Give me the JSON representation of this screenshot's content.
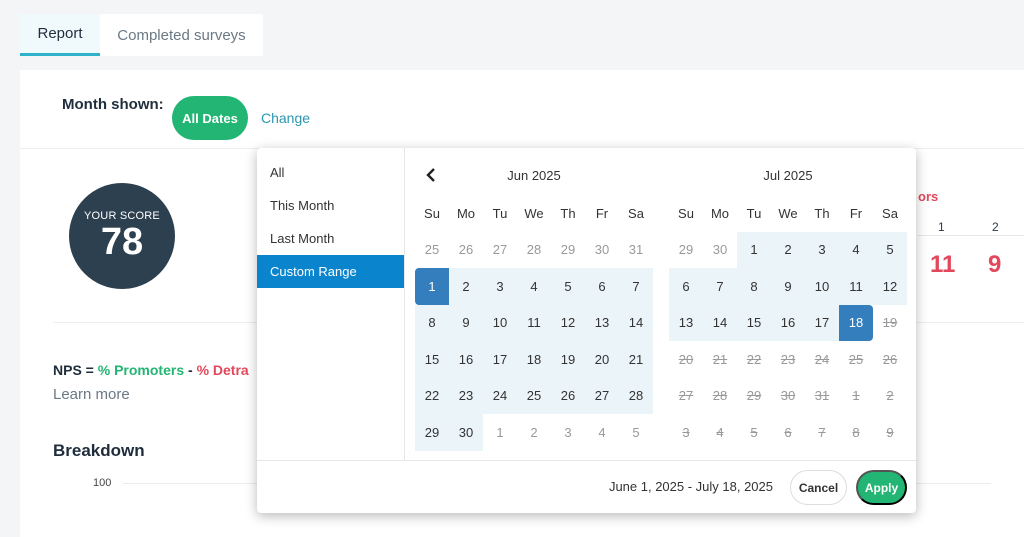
{
  "tabs": [
    {
      "label": "Report",
      "active": true
    },
    {
      "label": "Completed surveys",
      "active": false
    }
  ],
  "month": {
    "label": "Month shown:",
    "badge": "All Dates",
    "change": "Change"
  },
  "score": {
    "caption": "YOUR SCORE",
    "value": "78"
  },
  "nps": {
    "prefix": "NPS = ",
    "promoters": "% Promoters",
    "minus": " - ",
    "detractors": "% Detra"
  },
  "learn_more": "Learn more",
  "breakdown": "Breakdown",
  "axis_top": "100",
  "side": {
    "detractors_label": "ors",
    "col1": "1",
    "col2": "2",
    "count1": "11",
    "count2": "9"
  },
  "picker": {
    "ranges": [
      "All",
      "This Month",
      "Last Month",
      "Custom Range"
    ],
    "active_range": "Custom Range",
    "prev_icon": "chevron-left-icon",
    "weekdays": [
      "Su",
      "Mo",
      "Tu",
      "We",
      "Th",
      "Fr",
      "Sa"
    ],
    "months": [
      {
        "title": "Jun 2025",
        "days": [
          [
            "25",
            "off"
          ],
          [
            "26",
            "off"
          ],
          [
            "27",
            "off"
          ],
          [
            "28",
            "off"
          ],
          [
            "29",
            "off"
          ],
          [
            "30",
            "off"
          ],
          [
            "31",
            "off"
          ],
          [
            "1",
            "start"
          ],
          [
            "2",
            "in"
          ],
          [
            "3",
            "in"
          ],
          [
            "4",
            "in"
          ],
          [
            "5",
            "in"
          ],
          [
            "6",
            "in"
          ],
          [
            "7",
            "in"
          ],
          [
            "8",
            "in"
          ],
          [
            "9",
            "in"
          ],
          [
            "10",
            "in"
          ],
          [
            "11",
            "in"
          ],
          [
            "12",
            "in"
          ],
          [
            "13",
            "in"
          ],
          [
            "14",
            "in"
          ],
          [
            "15",
            "in"
          ],
          [
            "16",
            "in"
          ],
          [
            "17",
            "in"
          ],
          [
            "18",
            "in"
          ],
          [
            "19",
            "in"
          ],
          [
            "20",
            "in"
          ],
          [
            "21",
            "in"
          ],
          [
            "22",
            "in"
          ],
          [
            "23",
            "in"
          ],
          [
            "24",
            "in"
          ],
          [
            "25",
            "in"
          ],
          [
            "26",
            "in"
          ],
          [
            "27",
            "in"
          ],
          [
            "28",
            "in"
          ],
          [
            "29",
            "in"
          ],
          [
            "30",
            "in"
          ],
          [
            "1",
            "off"
          ],
          [
            "2",
            "off"
          ],
          [
            "3",
            "off"
          ],
          [
            "4",
            "off"
          ],
          [
            "5",
            "off"
          ]
        ]
      },
      {
        "title": "Jul 2025",
        "days": [
          [
            "29",
            "off"
          ],
          [
            "30",
            "off"
          ],
          [
            "1",
            "in"
          ],
          [
            "2",
            "in"
          ],
          [
            "3",
            "in"
          ],
          [
            "4",
            "in"
          ],
          [
            "5",
            "in"
          ],
          [
            "6",
            "in"
          ],
          [
            "7",
            "in"
          ],
          [
            "8",
            "in"
          ],
          [
            "9",
            "in"
          ],
          [
            "10",
            "in"
          ],
          [
            "11",
            "in"
          ],
          [
            "12",
            "in"
          ],
          [
            "13",
            "in"
          ],
          [
            "14",
            "in"
          ],
          [
            "15",
            "in"
          ],
          [
            "16",
            "in"
          ],
          [
            "17",
            "in"
          ],
          [
            "18",
            "end"
          ],
          [
            "19",
            "dis"
          ],
          [
            "20",
            "dis"
          ],
          [
            "21",
            "dis"
          ],
          [
            "22",
            "dis"
          ],
          [
            "23",
            "dis"
          ],
          [
            "24",
            "dis"
          ],
          [
            "25",
            "dis"
          ],
          [
            "26",
            "dis"
          ],
          [
            "27",
            "dis"
          ],
          [
            "28",
            "dis"
          ],
          [
            "29",
            "dis"
          ],
          [
            "30",
            "dis"
          ],
          [
            "31",
            "dis"
          ],
          [
            "1",
            "dis"
          ],
          [
            "2",
            "dis"
          ],
          [
            "3",
            "dis"
          ],
          [
            "4",
            "dis"
          ],
          [
            "5",
            "dis"
          ],
          [
            "6",
            "dis"
          ],
          [
            "7",
            "dis"
          ],
          [
            "8",
            "dis"
          ],
          [
            "9",
            "dis"
          ]
        ]
      }
    ],
    "range_text": "June 1, 2025 - July 18, 2025",
    "cancel": "Cancel",
    "apply": "Apply"
  },
  "colors": {
    "green": "#22b573",
    "blue_active": "#0b84ce",
    "selected": "#357ebd",
    "in_range": "#ebf4f8",
    "red": "#e2475b",
    "navy": "#2d4050"
  }
}
